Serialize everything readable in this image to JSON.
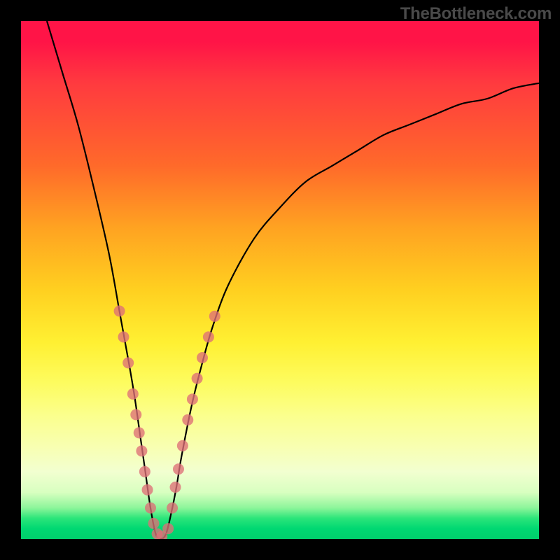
{
  "watermark": "TheBottleneck.com",
  "chart_data": {
    "type": "line",
    "title": "",
    "xlabel": "",
    "ylabel": "",
    "xlim": [
      0,
      100
    ],
    "ylim": [
      0,
      100
    ],
    "grid": false,
    "legend": false,
    "description": "V-shaped bottleneck curve over vertical rainbow gradient (red→green). Minimum near x≈26, y≈0. Pink dot markers cluster on both arms near the valley.",
    "series": [
      {
        "name": "curve",
        "color": "#000000",
        "x": [
          5,
          8,
          11,
          14,
          17,
          19,
          21,
          22,
          23,
          24,
          25,
          26,
          27,
          28,
          29,
          30,
          31,
          33,
          35,
          37,
          40,
          45,
          50,
          55,
          60,
          65,
          70,
          75,
          80,
          85,
          90,
          95,
          100
        ],
        "y": [
          100,
          90,
          80,
          68,
          55,
          44,
          33,
          27,
          20,
          13,
          6,
          1,
          0,
          1,
          5,
          10,
          16,
          26,
          34,
          41,
          49,
          58,
          64,
          69,
          72,
          75,
          78,
          80,
          82,
          84,
          85,
          87,
          88
        ]
      }
    ],
    "markers": {
      "color": "#de6f77",
      "radius": 8,
      "points": [
        {
          "x": 19.0,
          "y": 44
        },
        {
          "x": 19.8,
          "y": 39
        },
        {
          "x": 20.7,
          "y": 34
        },
        {
          "x": 21.6,
          "y": 28
        },
        {
          "x": 22.2,
          "y": 24
        },
        {
          "x": 22.8,
          "y": 20.5
        },
        {
          "x": 23.3,
          "y": 17
        },
        {
          "x": 23.9,
          "y": 13
        },
        {
          "x": 24.4,
          "y": 9.5
        },
        {
          "x": 25.0,
          "y": 6
        },
        {
          "x": 25.6,
          "y": 3
        },
        {
          "x": 26.3,
          "y": 1
        },
        {
          "x": 27.2,
          "y": 0.5
        },
        {
          "x": 28.4,
          "y": 2
        },
        {
          "x": 29.2,
          "y": 6
        },
        {
          "x": 29.8,
          "y": 10
        },
        {
          "x": 30.4,
          "y": 13.5
        },
        {
          "x": 31.2,
          "y": 18
        },
        {
          "x": 32.2,
          "y": 23
        },
        {
          "x": 33.1,
          "y": 27
        },
        {
          "x": 34.0,
          "y": 31
        },
        {
          "x": 35.0,
          "y": 35
        },
        {
          "x": 36.2,
          "y": 39
        },
        {
          "x": 37.4,
          "y": 43
        }
      ]
    }
  }
}
